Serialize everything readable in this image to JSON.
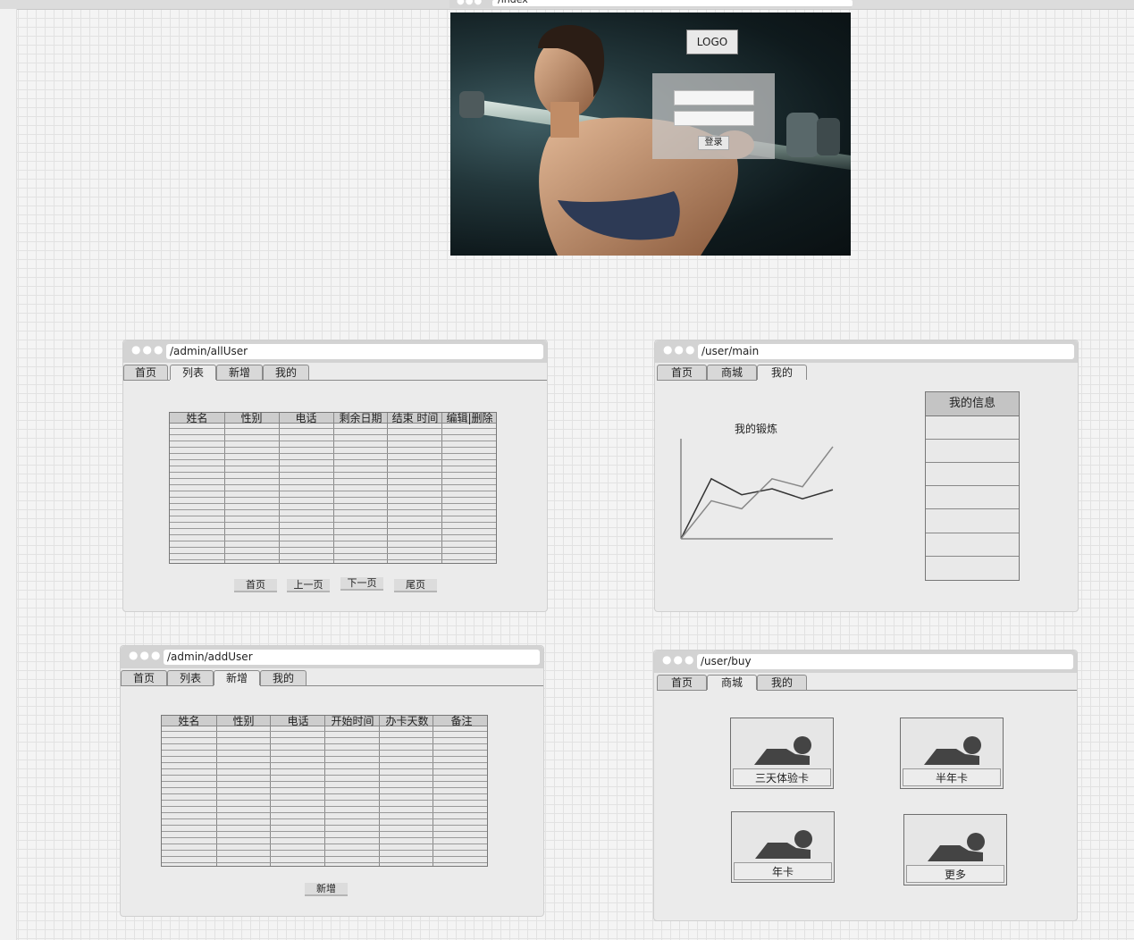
{
  "index_page": {
    "url": "/index",
    "logo": "LOGO",
    "login_button": "登录"
  },
  "all_user_page": {
    "url": "/admin/allUser",
    "tabs": [
      "首页",
      "列表",
      "新增",
      "我的"
    ],
    "active_tab": "列表",
    "columns": [
      "姓名",
      "性别",
      "电话",
      "剩余日期",
      "结束 时间",
      "编辑|删除"
    ],
    "pagination": [
      "首页",
      "上一页",
      "下一页",
      "尾页"
    ]
  },
  "user_main_page": {
    "url": "/user/main",
    "tabs": [
      "首页",
      "商城",
      "我的"
    ],
    "active_tab": "我的",
    "chart_title": "我的锻炼",
    "info_header": "我的信息"
  },
  "add_user_page": {
    "url": "/admin/addUser",
    "tabs": [
      "首页",
      "列表",
      "新增",
      "我的"
    ],
    "active_tab": "新增",
    "columns": [
      "姓名",
      "性别",
      "电话",
      "开始时间",
      "办卡天数",
      "备注"
    ],
    "add_button": "新增"
  },
  "user_buy_page": {
    "url": "/user/buy",
    "tabs": [
      "首页",
      "商城",
      "我的"
    ],
    "active_tab": "商城",
    "products": [
      "三天体验卡",
      "半年卡",
      "年卡",
      "更多"
    ]
  },
  "chart_data": {
    "type": "line",
    "title": "我的锻炼",
    "x": [
      0,
      1,
      2,
      3,
      4,
      5
    ],
    "series": [
      {
        "values": [
          0,
          6,
          4.4,
          5,
          4,
          4.9
        ],
        "color": "#333333"
      },
      {
        "values": [
          0,
          3.8,
          3,
          6,
          5.2,
          9.2
        ],
        "color": "#888888"
      }
    ],
    "ylim": [
      0,
      10
    ],
    "xlim": [
      0,
      5
    ],
    "grid": false
  }
}
